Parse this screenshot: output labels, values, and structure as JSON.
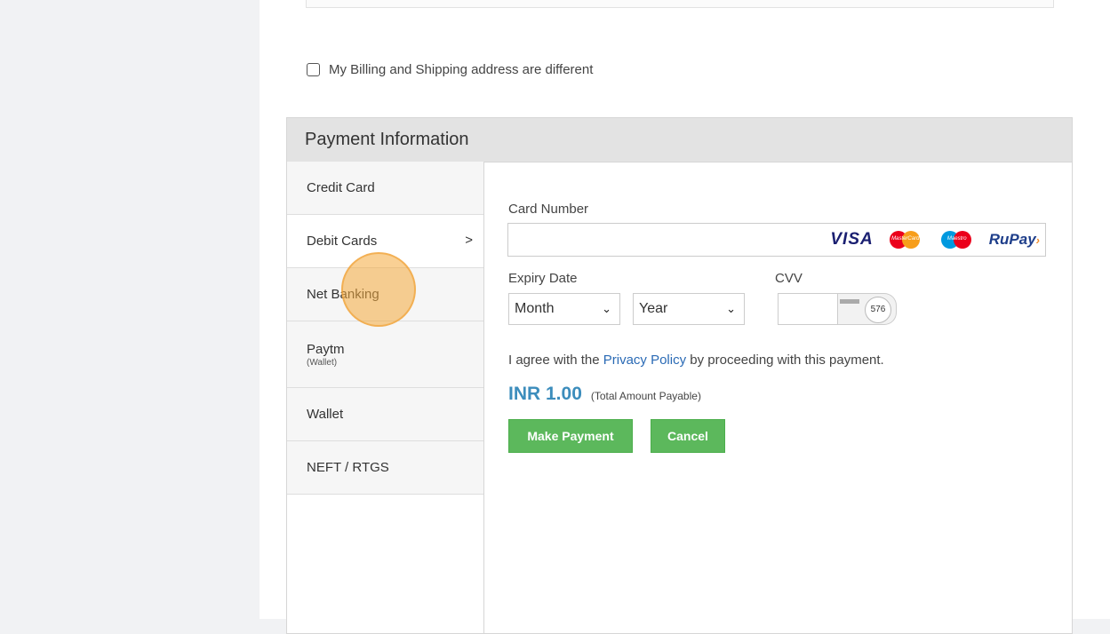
{
  "billing": {
    "label": "My Billing and Shipping address are different",
    "checked": false
  },
  "payment": {
    "title": "Payment Information",
    "methods": [
      {
        "label": "Credit Card"
      },
      {
        "label": "Debit Cards",
        "active": true,
        "chevron": ">"
      },
      {
        "label": "Net Banking"
      },
      {
        "label": "Paytm",
        "sub": "(Wallet)"
      },
      {
        "label": "Wallet"
      },
      {
        "label": "NEFT / RTGS"
      }
    ],
    "card_number_label": "Card Number",
    "card_logos": {
      "visa": "VISA",
      "mastercard": "MasterCard",
      "maestro": "Maestro",
      "rupay": "RuPay",
      "rupay_mark": "›"
    },
    "expiry_label": "Expiry Date",
    "month": "Month",
    "year": "Year",
    "select_arrow": "❯",
    "cvv_label": "CVV",
    "cvv_hint": "576",
    "agree_prefix": "I agree with the",
    "privacy_link": "Privacy Policy",
    "agree_suffix": "by proceeding with this payment.",
    "amount": "INR 1.00",
    "amount_note": "(Total Amount Payable)",
    "make_payment": "Make Payment",
    "cancel": "Cancel"
  },
  "colors": {
    "button": "#5cb85c",
    "amount": "#3c8dbc",
    "link": "#2a6ab5"
  }
}
